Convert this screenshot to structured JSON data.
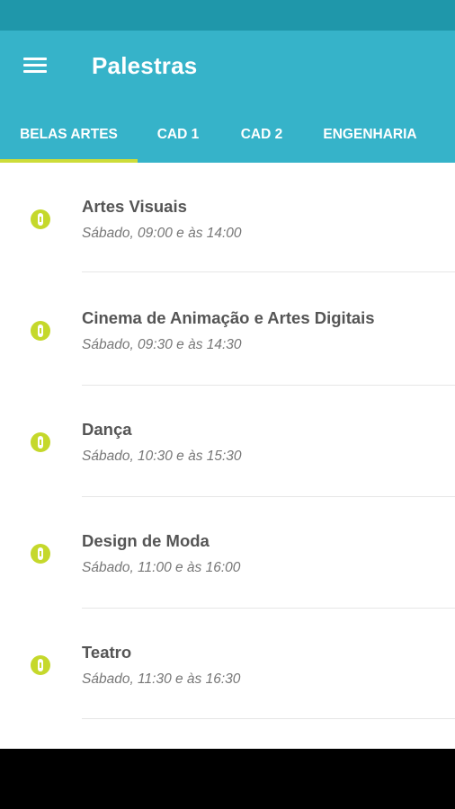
{
  "colors": {
    "status_bar": "#1f97aa",
    "app_bar": "#36b3c9",
    "accent": "#cddc39",
    "icon": "#c5d82b"
  },
  "app_bar": {
    "title": "Palestras",
    "menu_icon": "hamburger-menu-icon"
  },
  "tabs": [
    {
      "label": "BELAS ARTES",
      "selected": true
    },
    {
      "label": "CAD 1",
      "selected": false
    },
    {
      "label": "CAD 2",
      "selected": false
    },
    {
      "label": "ENGENHARIA",
      "selected": false
    }
  ],
  "items": [
    {
      "name": "Artes Visuais",
      "time": "Sábado, 09:00 e às 14:00",
      "icon": "info-icon"
    },
    {
      "name": "Cinema de Animação e Artes Digitais",
      "time": "Sábado, 09:30 e às 14:30",
      "icon": "info-icon"
    },
    {
      "name": "Dança",
      "time": "Sábado, 10:30 e às 15:30",
      "icon": "info-icon"
    },
    {
      "name": "Design de Moda",
      "time": "Sábado, 11:00 e às 16:00",
      "icon": "info-icon"
    },
    {
      "name": "Teatro",
      "time": "Sábado, 11:30 e às 16:30",
      "icon": "info-icon"
    }
  ]
}
